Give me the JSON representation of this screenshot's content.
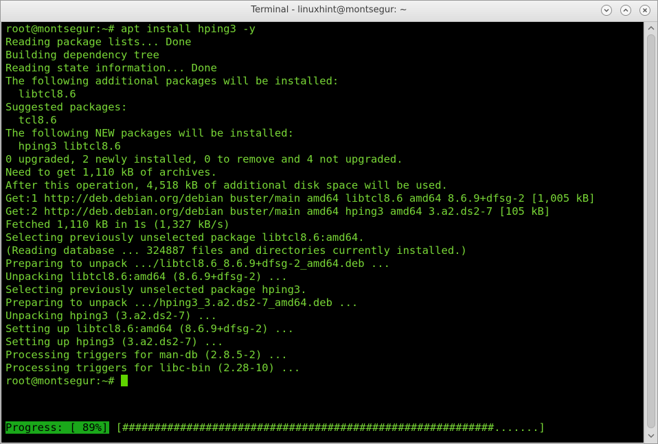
{
  "window": {
    "title": "Terminal - linuxhint@montsegur: ~"
  },
  "icons": {
    "minimize": "chevron-down-icon",
    "maximize": "chevron-up-icon",
    "close": "close-icon"
  },
  "colors": {
    "text": "#78d636",
    "background": "#000000",
    "progress_highlight": "#1aa81a",
    "cursor": "#5fd400"
  },
  "terminal": {
    "lines": [
      "root@montsegur:~# apt install hping3 -y",
      "Reading package lists... Done",
      "Building dependency tree",
      "Reading state information... Done",
      "The following additional packages will be installed:",
      "  libtcl8.6",
      "Suggested packages:",
      "  tcl8.6",
      "The following NEW packages will be installed:",
      "  hping3 libtcl8.6",
      "0 upgraded, 2 newly installed, 0 to remove and 4 not upgraded.",
      "Need to get 1,110 kB of archives.",
      "After this operation, 4,518 kB of additional disk space will be used.",
      "Get:1 http://deb.debian.org/debian buster/main amd64 libtcl8.6 amd64 8.6.9+dfsg-2 [1,005 kB]",
      "Get:2 http://deb.debian.org/debian buster/main amd64 hping3 amd64 3.a2.ds2-7 [105 kB]",
      "Fetched 1,110 kB in 1s (1,327 kB/s)",
      "Selecting previously unselected package libtcl8.6:amd64.",
      "(Reading database ... 324887 files and directories currently installed.)",
      "Preparing to unpack .../libtcl8.6_8.6.9+dfsg-2_amd64.deb ...",
      "Unpacking libtcl8.6:amd64 (8.6.9+dfsg-2) ...",
      "Selecting previously unselected package hping3.",
      "Preparing to unpack .../hping3_3.a2.ds2-7_amd64.deb ...",
      "Unpacking hping3 (3.a2.ds2-7) ...",
      "Setting up libtcl8.6:amd64 (8.6.9+dfsg-2) ...",
      "Setting up hping3 (3.a2.ds2-7) ...",
      "Processing triggers for man-db (2.8.5-2) ...",
      "Processing triggers for libc-bin (2.28-10) ..."
    ],
    "prompt": "root@montsegur:~# ",
    "progress": {
      "label": "Progress: [ 89%]",
      "bar": "[##########################################################.......]",
      "percent": 89
    }
  }
}
